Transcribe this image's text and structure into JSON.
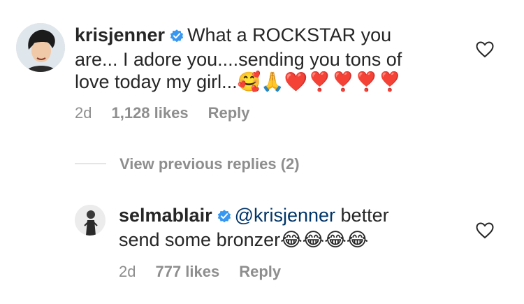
{
  "comment": {
    "username": "krisjenner",
    "line1": "What a ROCKSTAR you",
    "line2": "are... I adore you....sending you tons of",
    "line3": "love today my girl...",
    "emojis": "🥰🙏❤️❣️❣️❣️❣️",
    "time": "2d",
    "likes": "1,128 likes",
    "reply_label": "Reply"
  },
  "view_replies": {
    "label": "View previous replies (2)"
  },
  "reply": {
    "username": "selmablair",
    "mention": "@krisjenner",
    "text_rest": " better",
    "line2": "send some bronzer",
    "emojis": "😂😂😂😂",
    "time": "2d",
    "likes": "777 likes",
    "reply_label": "Reply"
  },
  "icons": {
    "verified": "verified-badge-icon",
    "like": "heart-outline-icon"
  },
  "colors": {
    "verified_blue": "#3897f0",
    "mention_blue": "#003569",
    "meta_gray": "#8e8e8e"
  }
}
